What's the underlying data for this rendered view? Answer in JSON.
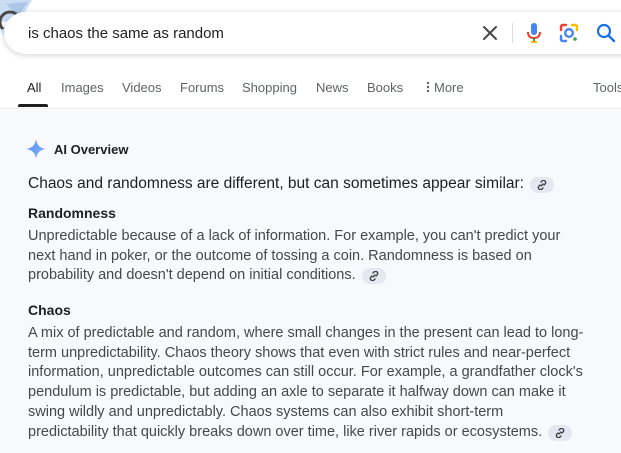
{
  "search": {
    "query": "is chaos the same as random"
  },
  "icons": {
    "clear": "close-icon",
    "voice": "microphone-icon",
    "lens": "lens-icon",
    "search": "search-icon",
    "more": "vertical-dots-icon",
    "overview": "sparkle-icon",
    "source_link": "link-icon"
  },
  "colors": {
    "active_tab": "#1f1f1f",
    "inactive_tab": "#5f6368",
    "search_blue": "#1a73e8",
    "overview_bg": "#f7f9fc",
    "chip_bg": "#e3e8f1"
  },
  "tabs": {
    "all": "All",
    "images": "Images",
    "videos": "Videos",
    "forums": "Forums",
    "shopping": "Shopping",
    "news": "News",
    "books": "Books",
    "more": "More",
    "tools": "Tools"
  },
  "overview": {
    "title": "AI Overview",
    "intro": "Chaos and randomness are different, but can sometimes appear similar:",
    "sections": [
      {
        "heading": "Randomness",
        "lines": [
          "Unpredictable because of a lack of information. For example, you can't predict your",
          "next hand in poker, or the outcome of tossing a coin. Randomness is based on",
          "probability and doesn't depend on initial conditions."
        ]
      },
      {
        "heading": "Chaos",
        "lines": [
          "A mix of predictable and random, where small changes in the present can lead to long-",
          "term unpredictability. Chaos theory shows that even with strict rules and near-perfect",
          "information, unpredictable outcomes can still occur. For example, a grandfather clock's",
          "pendulum is predictable, but adding an axle to separate it halfway down can make it",
          "swing wildly and unpredictably. Chaos systems can also exhibit short-term",
          "predictability that quickly breaks down over time, like river rapids or ecosystems."
        ]
      }
    ]
  }
}
